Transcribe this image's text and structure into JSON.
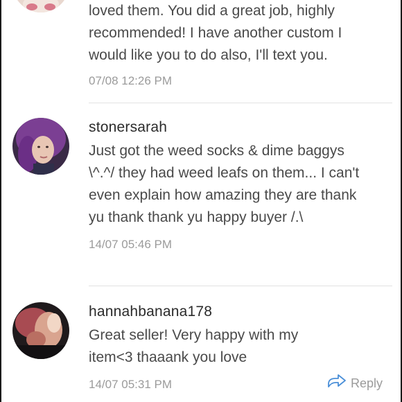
{
  "reviews": [
    {
      "text": "loved them. You did a great job, highly recommended! I have another custom I would like you to do also, I'll text you.",
      "date": "07/08 12:26 PM"
    },
    {
      "username": "stonersarah",
      "text": "Just got the weed socks & dime baggys \\^.^/ they had weed leafs on them... I can't even explain how amazing they are thank yu thank thank yu happy buyer /.\\",
      "date": "14/07 05:46 PM"
    },
    {
      "username": "hannahbanana178",
      "text": "Great seller! Very happy with my item<3 thaaank you love",
      "date": "14/07 05:31 PM",
      "reply_label": "Reply"
    }
  ]
}
